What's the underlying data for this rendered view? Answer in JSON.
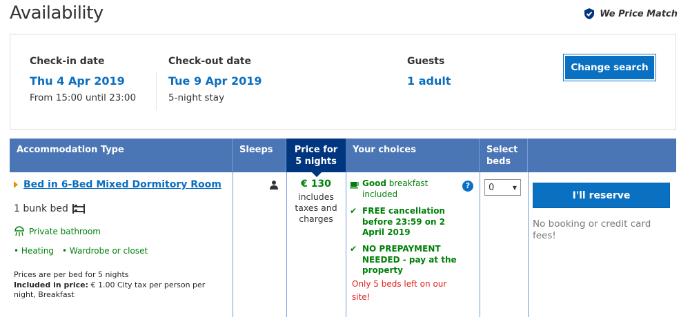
{
  "header": {
    "title": "Availability",
    "price_match": "We Price Match"
  },
  "search": {
    "checkin_label": "Check-in date",
    "checkin_date": "Thu 4 Apr 2019",
    "checkin_time": "From 15:00 until 23:00",
    "checkout_label": "Check-out date",
    "checkout_date": "Tue 9 Apr 2019",
    "stay_length": "5-night stay",
    "guests_label": "Guests",
    "guests_value": "1 adult",
    "change_button": "Change search"
  },
  "table": {
    "headers": {
      "accommodation": "Accommodation Type",
      "sleeps": "Sleeps",
      "price_line1": "Price for",
      "price_line2": "5 nights",
      "choices": "Your choices",
      "beds_line1": "Select",
      "beds_line2": "beds"
    },
    "row": {
      "room_name": "Bed in 6-Bed Mixed Dormitory Room",
      "bed_info": "1 bunk bed",
      "facility": "Private bathroom",
      "amenities": [
        "Heating",
        "Wardrobe or closet"
      ],
      "price_note_1": "Prices are per bed for 5 nights",
      "included_label": "Included in price:",
      "included_text": "€ 1.00 City tax per person per night, Breakfast",
      "price": "€ 130",
      "price_sub": "includes taxes and charges",
      "breakfast_strong": "Good",
      "breakfast_text": "breakfast included",
      "cancellation": "FREE cancellation before 23:59 on 2 April 2019",
      "prepayment": "NO PREPAYMENT NEEDED - pay at the property",
      "availability": "Only 5 beds left on our site!",
      "beds_selected": "0",
      "reserve_button": "I'll reserve",
      "reserve_note": "No booking or credit card fees!"
    }
  },
  "colors": {
    "link_blue": "#0a6ec0",
    "header_blue": "#4b76b6",
    "price_header": "#003580",
    "green": "#008009",
    "red": "#e41c1c"
  }
}
